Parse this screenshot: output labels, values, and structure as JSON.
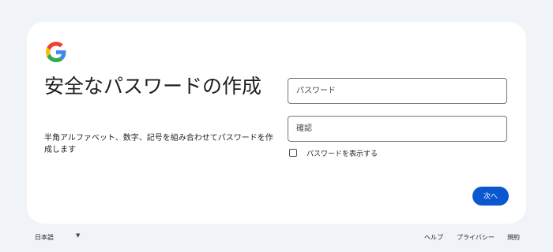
{
  "header": {
    "logo_icon": "google-g-logo",
    "title": "安全なパスワードの作成",
    "subtitle": "半角アルファベット、数字、記号を組み合わせてパスワードを作成します"
  },
  "form": {
    "password_placeholder": "パスワード",
    "confirm_placeholder": "確認",
    "show_password_label": "パスワードを表示する",
    "show_password_checked": false,
    "next_label": "次へ"
  },
  "footer": {
    "language": "日本語",
    "links": [
      "ヘルプ",
      "プライバシー",
      "規約"
    ]
  },
  "colors": {
    "page_background": "#f0f4f9",
    "card_background": "#ffffff",
    "accent": "#0b57d0"
  }
}
